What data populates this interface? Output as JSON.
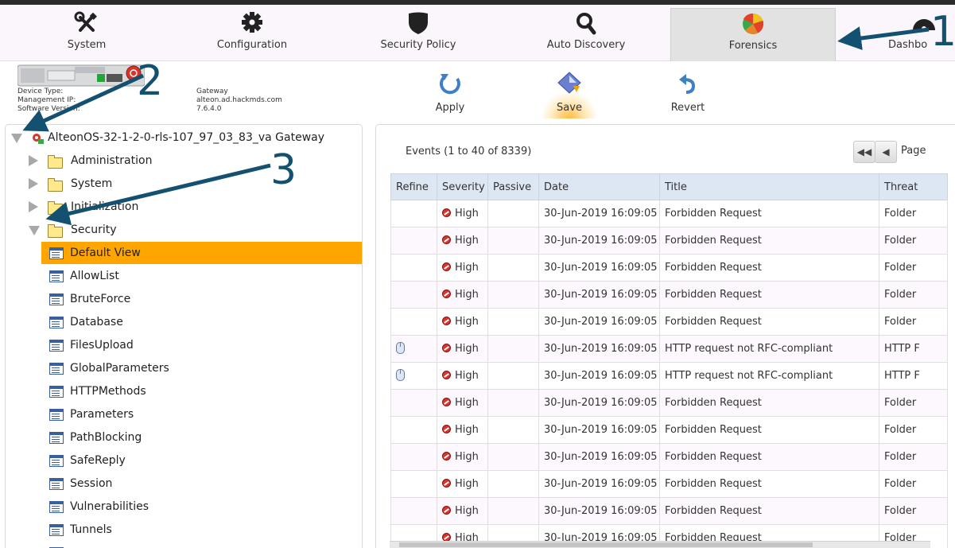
{
  "nav": {
    "items": [
      {
        "label": "System",
        "icon": "tools-icon"
      },
      {
        "label": "Configuration",
        "icon": "gear-icon"
      },
      {
        "label": "Security Policy",
        "icon": "shield-icon"
      },
      {
        "label": "Auto Discovery",
        "icon": "magnifier-icon"
      },
      {
        "label": "Forensics",
        "icon": "pie-chart-icon",
        "active": true
      },
      {
        "label": "Dashbo",
        "icon": "dashboard-icon"
      }
    ]
  },
  "device": {
    "labels": [
      "Device Type:",
      "Management IP:",
      "Software Version:"
    ],
    "values": [
      "Gateway",
      "alteon.ad.hackmds.com",
      "7.6.4.0"
    ]
  },
  "toolbar": {
    "apply": "Apply",
    "save": "Save",
    "revert": "Revert"
  },
  "tree": {
    "root": "AlteonOS-32-1-2-0-rls-107_97_03_83_va Gateway",
    "folders": [
      "Administration",
      "System",
      "Initialization",
      "Security"
    ],
    "views": [
      "Default View",
      "AllowList",
      "BruteForce",
      "Database",
      "FilesUpload",
      "GlobalParameters",
      "HTTPMethods",
      "Parameters",
      "PathBlocking",
      "SafeReply",
      "Session",
      "Vulnerabilities",
      "Tunnels"
    ],
    "selected_view": "Default View"
  },
  "events": {
    "count_label": "Events (1 to 40 of 8339)",
    "page_label": "Page",
    "columns": [
      "Refine",
      "Severity",
      "Passive",
      "Date",
      "Title",
      "Threat"
    ],
    "rows": [
      {
        "refine": false,
        "severity": "High",
        "date": "30-Jun-2019 16:09:05",
        "title": "Forbidden Request",
        "threat": "Folder"
      },
      {
        "refine": false,
        "severity": "High",
        "date": "30-Jun-2019 16:09:05",
        "title": "Forbidden Request",
        "threat": "Folder"
      },
      {
        "refine": false,
        "severity": "High",
        "date": "30-Jun-2019 16:09:05",
        "title": "Forbidden Request",
        "threat": "Folder"
      },
      {
        "refine": false,
        "severity": "High",
        "date": "30-Jun-2019 16:09:05",
        "title": "Forbidden Request",
        "threat": "Folder"
      },
      {
        "refine": false,
        "severity": "High",
        "date": "30-Jun-2019 16:09:05",
        "title": "Forbidden Request",
        "threat": "Folder"
      },
      {
        "refine": true,
        "severity": "High",
        "date": "30-Jun-2019 16:09:05",
        "title": "HTTP request not RFC-compliant",
        "threat": "HTTP F"
      },
      {
        "refine": true,
        "severity": "High",
        "date": "30-Jun-2019 16:09:05",
        "title": "HTTP request not RFC-compliant",
        "threat": "HTTP F"
      },
      {
        "refine": false,
        "severity": "High",
        "date": "30-Jun-2019 16:09:05",
        "title": "Forbidden Request",
        "threat": "Folder"
      },
      {
        "refine": false,
        "severity": "High",
        "date": "30-Jun-2019 16:09:05",
        "title": "Forbidden Request",
        "threat": "Folder"
      },
      {
        "refine": false,
        "severity": "High",
        "date": "30-Jun-2019 16:09:05",
        "title": "Forbidden Request",
        "threat": "Folder"
      },
      {
        "refine": false,
        "severity": "High",
        "date": "30-Jun-2019 16:09:05",
        "title": "Forbidden Request",
        "threat": "Folder"
      },
      {
        "refine": false,
        "severity": "High",
        "date": "30-Jun-2019 16:09:05",
        "title": "Forbidden Request",
        "threat": "Folder"
      },
      {
        "refine": false,
        "severity": "High",
        "date": "30-Jun-2019 16:09:05",
        "title": "Forbidden Request",
        "threat": "Folder"
      }
    ]
  },
  "annotations": [
    "1",
    "2",
    "3"
  ],
  "colors": {
    "selected": "#ffa500",
    "annotation": "#14506f",
    "header": "#dde6f3",
    "high": "#e1312a"
  }
}
